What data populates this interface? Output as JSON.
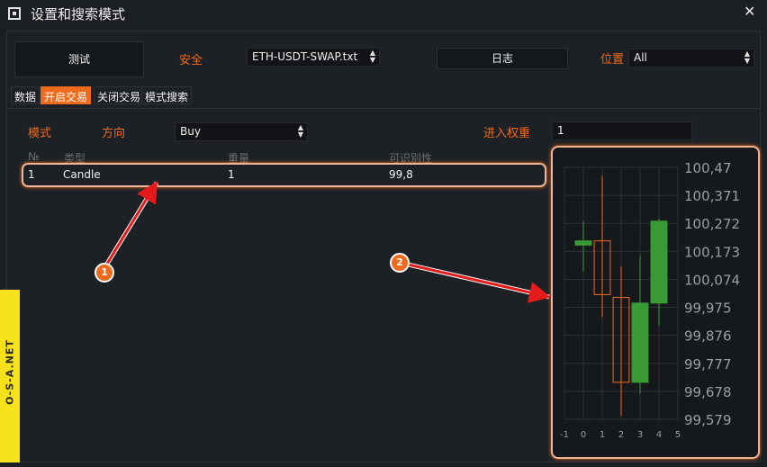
{
  "window": {
    "title": "设置和搜索模式",
    "close_glyph": "✕"
  },
  "top": {
    "test_button": "测试",
    "security_label": "安全",
    "security_value": "ETH-USDT-SWAP.txt",
    "log_button": "日志",
    "position_label": "位置",
    "position_value": "All"
  },
  "tabs": [
    {
      "label": "数据",
      "active": false
    },
    {
      "label": "开启交易",
      "active": true
    },
    {
      "label": "关闭交易",
      "active": false
    },
    {
      "label": "模式搜索",
      "active": false
    }
  ],
  "form": {
    "mode_label": "模式",
    "direction_label": "方向",
    "direction_value": "Buy",
    "entry_weight_label": "进入权重",
    "entry_weight_value": "1"
  },
  "table": {
    "headers": [
      "№",
      "类型",
      "重量",
      "可识别性"
    ],
    "rows": [
      {
        "no": "1",
        "type": "Candle",
        "weight": "1",
        "recognition": "99,8"
      }
    ]
  },
  "annotations": {
    "badge1": "1",
    "badge2": "2"
  },
  "watermark": "O-S-A.NET",
  "colors": {
    "accent": "#ee6a1c",
    "bull": "#3a9a35",
    "bear": "#ee6a1c",
    "highlight": "#f2b49a"
  },
  "chart_data": {
    "type": "candlestick",
    "x_ticks": [
      "-1",
      "0",
      "1",
      "2",
      "3",
      "4",
      "5"
    ],
    "y_ticks": [
      "100,47",
      "100,371",
      "100,272",
      "100,173",
      "100,074",
      "99,975",
      "99,876",
      "99,777",
      "99,678",
      "99,579"
    ],
    "ylim": [
      99.579,
      100.47
    ],
    "xlim": [
      -1,
      5
    ],
    "grid": true,
    "candles": [
      {
        "x": 0,
        "open": 100.21,
        "close": 100.195,
        "high": 100.28,
        "low": 100.1,
        "color": "bull"
      },
      {
        "x": 1,
        "open": 100.21,
        "close": 100.02,
        "high": 100.44,
        "low": 99.94,
        "color": "bear"
      },
      {
        "x": 2,
        "open": 100.01,
        "close": 99.71,
        "high": 100.12,
        "low": 99.59,
        "color": "bear"
      },
      {
        "x": 3,
        "open": 99.71,
        "close": 99.99,
        "high": 100.16,
        "low": 99.67,
        "color": "bull"
      },
      {
        "x": 4,
        "open": 99.99,
        "close": 100.28,
        "high": 100.29,
        "low": 99.91,
        "color": "bull"
      }
    ]
  }
}
